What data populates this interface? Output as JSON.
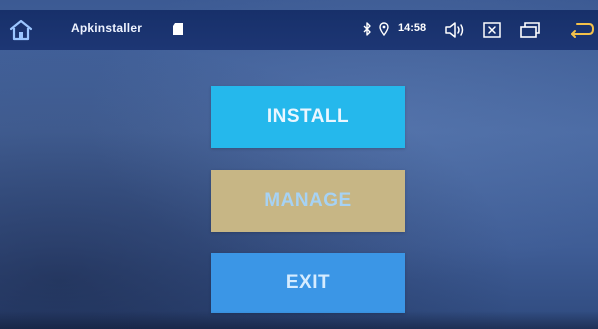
{
  "status_bar": {
    "app_title": "Apkinstaller",
    "time": "14:58",
    "icons": {
      "home": "home-icon",
      "storage": "sd-card-icon",
      "bluetooth": "bluetooth-icon",
      "location": "location-icon",
      "volume": "volume-icon",
      "close": "close-box-icon",
      "recents": "recent-apps-icon",
      "back": "back-arrow-icon"
    }
  },
  "main": {
    "install_label": "INSTALL",
    "manage_label": "MANAGE",
    "exit_label": "EXIT"
  },
  "colors": {
    "status_bar": "#17306a",
    "background": "#4a6aa3",
    "install": "#25b8ec",
    "manage": "#c7b685",
    "exit": "#3b96e6"
  }
}
